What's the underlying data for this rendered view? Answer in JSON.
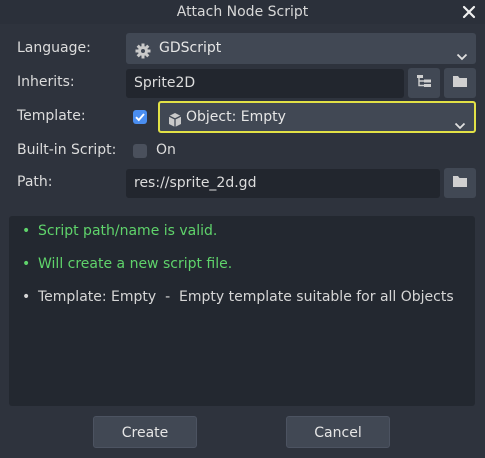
{
  "window": {
    "title": "Attach Node Script"
  },
  "language": {
    "label": "Language:",
    "value": "GDScript",
    "icon": "gear-icon"
  },
  "inherits": {
    "label": "Inherits:",
    "value": "Sprite2D"
  },
  "template": {
    "label": "Template:",
    "checked": true,
    "value": "Object: Empty",
    "icon": "object-icon",
    "highlight_color": "#e2e146"
  },
  "builtin": {
    "label": "Built-in Script:",
    "checked": false,
    "option_label": "On"
  },
  "path": {
    "label": "Path:",
    "value": "res://sprite_2d.gd"
  },
  "messages": [
    {
      "text": "Script path/name is valid.",
      "color": "#5fd36b"
    },
    {
      "text": "Will create a new script file.",
      "color": "#5fd36b"
    },
    {
      "text": "Template: Empty  -  Empty template suitable for all Objects",
      "color": "#d6d6d6"
    }
  ],
  "buttons": {
    "create": "Create",
    "cancel": "Cancel"
  },
  "colors": {
    "accent": "#4a8ef1",
    "valid": "#5fd36b"
  }
}
